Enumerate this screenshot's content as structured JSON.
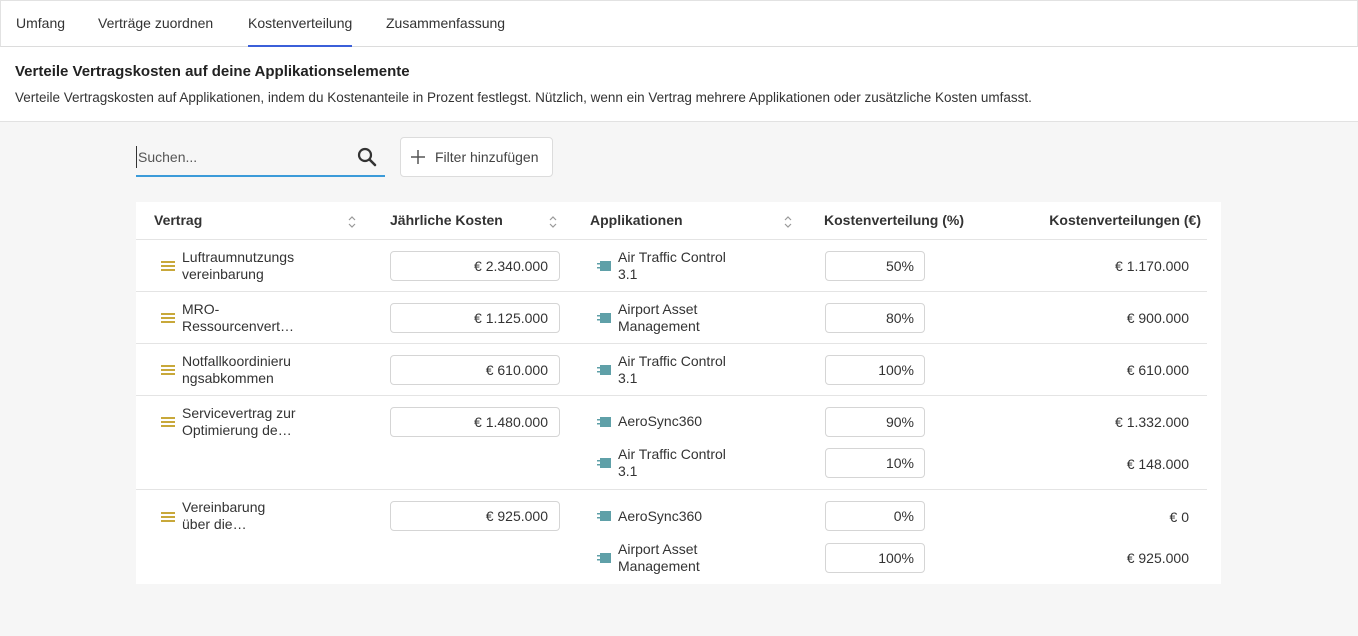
{
  "tabs": [
    {
      "label": "Umfang"
    },
    {
      "label": "Verträge zuordnen"
    },
    {
      "label": "Kostenverteilung"
    },
    {
      "label": "Zusammenfassung"
    }
  ],
  "header": {
    "title": "Verteile Vertragskosten auf deine Applikationselemente",
    "description": "Verteile Vertragskosten auf Applikationen, indem du Kostenanteile in Prozent festlegst. Nützlich, wenn ein Vertrag mehrere Applikationen oder zusätzliche Kosten umfasst."
  },
  "search": {
    "placeholder": "Suchen...",
    "value": ""
  },
  "filter_button": {
    "label": "Filter hinzufügen"
  },
  "table": {
    "columns": [
      "Vertrag",
      "Jährliche Kosten",
      "Applikationen",
      "Kostenverteilung (%)",
      "Kostenverteilungen (€)"
    ],
    "rows": [
      {
        "contract_l1": "Luftraumnutzungs",
        "contract_l2": "vereinbarung",
        "cost": "€ 2.340.000",
        "apps": [
          {
            "l1": "Air Traffic Control",
            "l2": "3.1",
            "pct": "50%",
            "amount": "€ 1.170.000"
          }
        ]
      },
      {
        "contract_l1": "MRO-",
        "contract_l2": "Ressourcenvert…",
        "cost": "€ 1.125.000",
        "apps": [
          {
            "l1": "Airport Asset",
            "l2": "Management",
            "pct": "80%",
            "amount": "€ 900.000"
          }
        ]
      },
      {
        "contract_l1": "Notfallkoordinieru",
        "contract_l2": "ngsabkommen",
        "cost": "€ 610.000",
        "apps": [
          {
            "l1": "Air Traffic Control",
            "l2": "3.1",
            "pct": "100%",
            "amount": "€ 610.000"
          }
        ]
      },
      {
        "contract_l1": "Servicevertrag zur",
        "contract_l2": "Optimierung de…",
        "cost": "€ 1.480.000",
        "apps": [
          {
            "l1": "AeroSync360",
            "l2": "",
            "pct": "90%",
            "amount": "€ 1.332.000"
          },
          {
            "l1": "Air Traffic Control",
            "l2": "3.1",
            "pct": "10%",
            "amount": "€ 148.000"
          }
        ]
      },
      {
        "contract_l1": "Vereinbarung",
        "contract_l2": "über die…",
        "cost": "€ 925.000",
        "apps": [
          {
            "l1": "AeroSync360",
            "l2": "",
            "pct": "0%",
            "amount": "€ 0"
          },
          {
            "l1": "Airport Asset",
            "l2": "Management",
            "pct": "100%",
            "amount": "€ 925.000"
          }
        ]
      }
    ]
  },
  "icons": {
    "contract": "contract-lines-icon",
    "app": "application-icon",
    "search": "search-icon",
    "add": "plus-icon",
    "sort": "sort-icon"
  },
  "colors": {
    "tab_active": "#3b5fd9",
    "search_underline": "#3b9bd9",
    "contract_icon": "#c8a83a",
    "app_icon": "#5fa0a8"
  }
}
